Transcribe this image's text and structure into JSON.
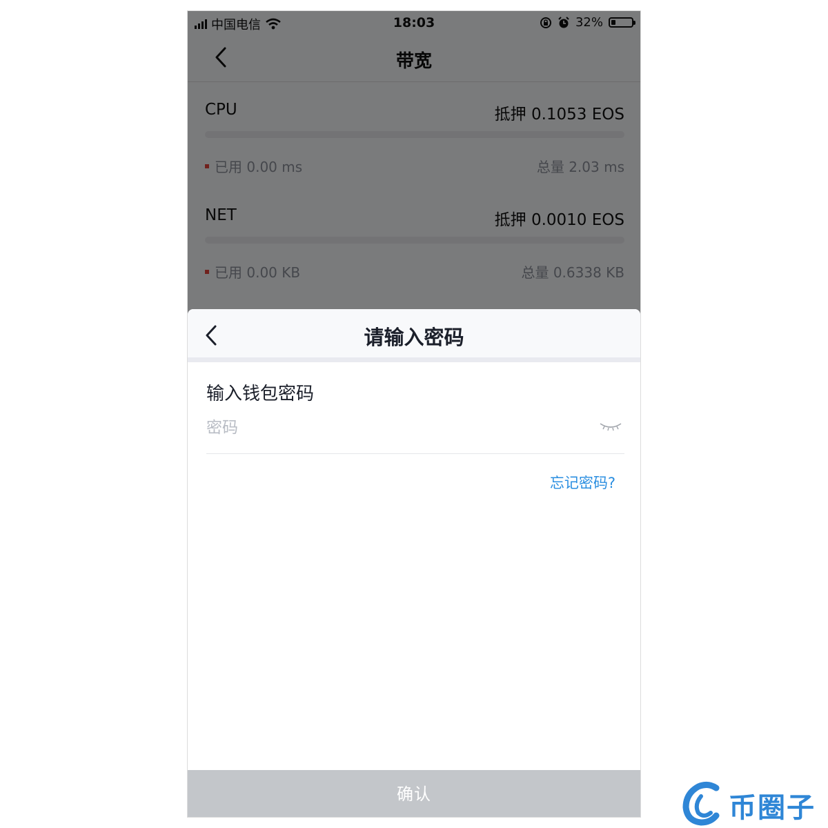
{
  "status_bar": {
    "carrier": "中国电信",
    "time": "18:03",
    "battery_pct": "32%",
    "battery_level": 0.32
  },
  "nav": {
    "title": "带宽",
    "back_icon": "chevron-left-icon"
  },
  "resources": [
    {
      "name": "CPU",
      "stake": "抵押 0.1053 EOS",
      "used": "已用 0.00 ms",
      "total": "总量 2.03 ms",
      "used_fraction": 0.0
    },
    {
      "name": "NET",
      "stake": "抵押 0.0010 EOS",
      "used": "已用 0.00 KB",
      "total": "总量 0.6338 KB",
      "used_fraction": 0.0
    }
  ],
  "password_sheet": {
    "title": "请输入密码",
    "field_label": "输入钱包密码",
    "placeholder": "密码",
    "forgot_link": "忘记密码?",
    "confirm_button": "确认",
    "eye_icon": "eye-closed-icon"
  },
  "watermark": {
    "text": "币圈子"
  },
  "colors": {
    "accent_link": "#2a8ee0",
    "used_marker": "#e0433a",
    "confirm_disabled": "#c3c6ca",
    "watermark": "#2f86d6"
  }
}
